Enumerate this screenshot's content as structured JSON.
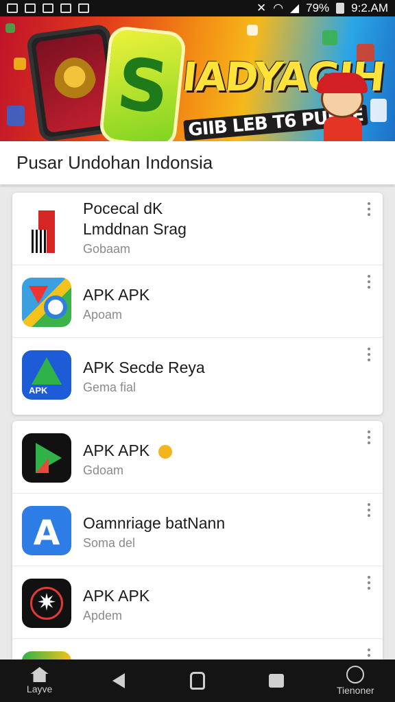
{
  "status_bar": {
    "battery_text": "79%",
    "time": "9:2.AM"
  },
  "banner": {
    "title": "IADYAGIH",
    "subtitle": "GIIB LEB T6 PUBEE"
  },
  "header": {
    "title": "Pusar Undohan Indonsia"
  },
  "cards": [
    {
      "rows": [
        {
          "icon": "piano-icon",
          "title": "Pocecal dK",
          "title2": "Lmddnan Srag",
          "subtitle": "Gobaam"
        },
        {
          "icon": "maps-icon",
          "title": "APK APK",
          "subtitle": "Apoam"
        },
        {
          "icon": "drive-icon",
          "title": "APK Secde Reya",
          "subtitle": "Gema fial",
          "icon_label": "APK"
        }
      ]
    },
    {
      "rows": [
        {
          "icon": "play-icon",
          "title": "APK APK",
          "subtitle": "Gdoam"
        },
        {
          "icon": "appstore-icon",
          "title": "Oamnriage batNann",
          "subtitle": "Soma del"
        },
        {
          "icon": "shutter-icon",
          "title": "APK APK",
          "subtitle": "Apdem"
        }
      ]
    }
  ],
  "nav": {
    "home_label": "Layve",
    "right_label": "Tienoner"
  },
  "colors": {
    "banner_accent": "#ffe23a",
    "nav_background": "#141414"
  }
}
